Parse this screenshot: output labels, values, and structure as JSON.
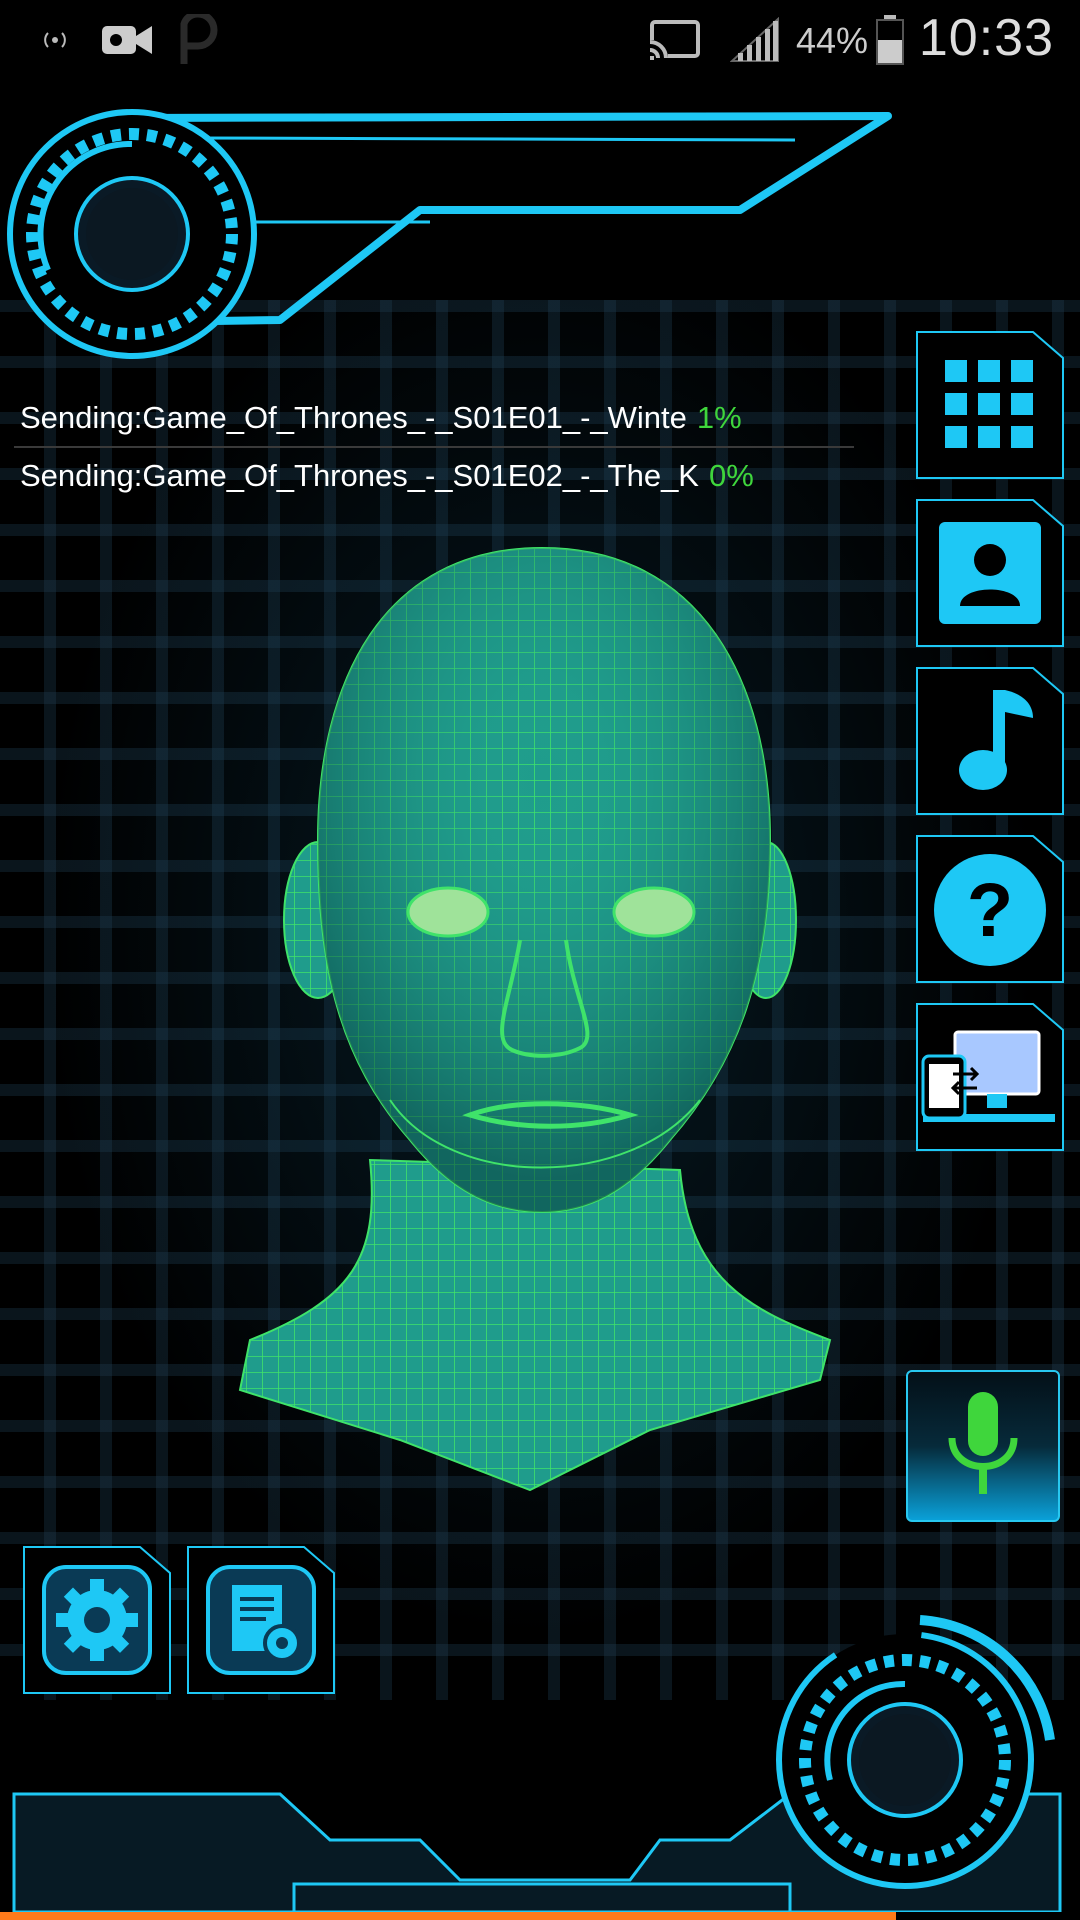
{
  "status_bar": {
    "battery_percent": "44%",
    "time": "10:33",
    "icons": [
      "radio-broadcast-icon",
      "video-camera-icon",
      "p-icon",
      "cast-icon",
      "signal-icon",
      "battery-icon"
    ]
  },
  "transfers": [
    {
      "label": "Sending:Game_Of_Thrones_-_S01E01_-_Winte",
      "percent": "1%"
    },
    {
      "label": "Sending:Game_Of_Thrones_-_S01E02_-_The_K",
      "percent": "0%"
    }
  ],
  "side_buttons": [
    "app-grid-icon",
    "contacts-icon",
    "music-note-icon",
    "help-icon",
    "phone-to-pc-icon"
  ],
  "bottom_buttons": [
    "settings-gear-icon",
    "document-settings-icon"
  ],
  "colors": {
    "accent": "#1ec8f5",
    "hud_dark": "#0a1a26",
    "progress_green": "#3fd63c",
    "mesh": "#28d46a",
    "bottom_progress": "#ff7a1a"
  },
  "bottom_progress": 0.83
}
